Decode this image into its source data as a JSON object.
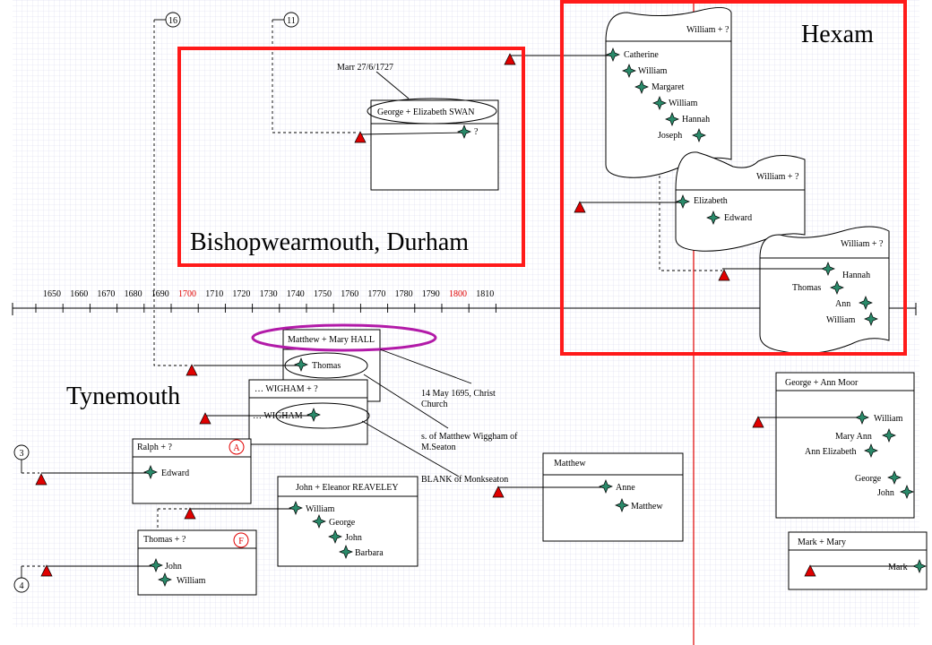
{
  "timeline": {
    "ticks": [
      "1650",
      "1660",
      "1670",
      "1680",
      "1690",
      "1700",
      "1710",
      "1720",
      "1730",
      "1740",
      "1750",
      "1760",
      "1770",
      "1780",
      "1790",
      "1800",
      "1810"
    ],
    "highlight_ticks": [
      "1700",
      "1800"
    ]
  },
  "regions": {
    "hexam": "Hexam",
    "bishopwearmouth": "Bishopwearmouth, Durham",
    "tynemouth": "Tynemouth"
  },
  "connectors": {
    "c16": "16",
    "c11": "11",
    "c3": "3",
    "c4": "4"
  },
  "families": {
    "hexam_1": {
      "title": "William + ?",
      "children": [
        "Catherine",
        "William",
        "Margaret",
        "William",
        "Hannah",
        "Joseph"
      ]
    },
    "hexam_2": {
      "title": "William + ?",
      "children": [
        "Elizabeth",
        "Edward"
      ]
    },
    "hexam_3": {
      "title": "William + ?",
      "children": [
        "Hannah",
        "Thomas",
        "Ann",
        "William"
      ]
    },
    "swan": {
      "title": "George + Elizabeth SWAN",
      "children": [
        "?"
      ],
      "note": "Marr 27/6/1727"
    },
    "hall": {
      "title": "Matthew + Mary HALL",
      "children": [
        "Thomas"
      ]
    },
    "wigham": {
      "title": "… WIGHAM + ?",
      "children": [
        "… WIGHAM"
      ]
    },
    "ralph": {
      "title": "Ralph + ?",
      "badge": "A",
      "children": [
        "Edward"
      ]
    },
    "reaveley": {
      "title": "John + Eleanor REAVELEY",
      "children": [
        "William",
        "George",
        "John",
        "Barbara"
      ]
    },
    "thomas": {
      "title": "Thomas + ?",
      "badge": "F",
      "children": [
        "John",
        "William"
      ]
    },
    "matthew": {
      "title": "Matthew",
      "children": [
        "Anne",
        "Matthew"
      ]
    },
    "moor": {
      "title": "George + Ann Moor",
      "children": [
        "William",
        "Mary Ann",
        "Ann Elizabeth",
        "George",
        "John"
      ]
    },
    "mark": {
      "title": "Mark + Mary",
      "children": [
        "Mark"
      ]
    }
  },
  "notes": {
    "christ_church": [
      "14 May 1695, Christ",
      "Church"
    ],
    "seaton": [
      "s. of Matthew Wiggham of",
      "M.Seaton"
    ],
    "monkseaton": "BLANK of  Monkseaton"
  },
  "colors": {
    "region_border": "#ff1a1a",
    "marker": "#e00000",
    "person_star": "#2a8a6a",
    "hall_ellipse": "#b21aa8",
    "grid": "#d8d8ee",
    "red_line": "#e00000"
  }
}
